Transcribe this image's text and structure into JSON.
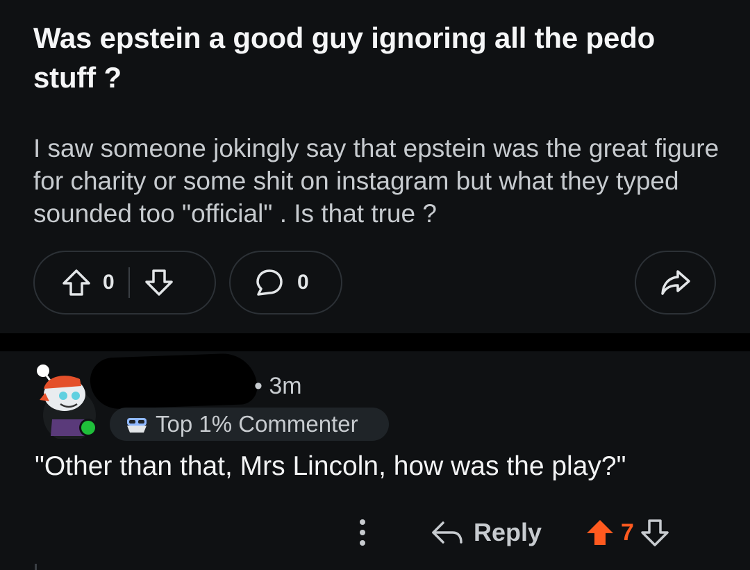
{
  "post": {
    "title": "Was epstein a good guy ignoring all the pedo stuff ?",
    "body": "I saw someone jokingly say that epstein was the great figure for charity or some shit on instagram but what they typed sounded too \"official\" . Is that true ?",
    "vote_count": "0",
    "comment_count": "0"
  },
  "comment": {
    "time": "• 3m",
    "badge": "Top 1% Commenter",
    "text": "\"Other than that, Mrs Lincoln, how was the play?\"",
    "reply_label": "Reply",
    "score": "7"
  },
  "icons": {
    "upvote": "arrow-up-outline-icon",
    "downvote": "arrow-down-outline-icon",
    "comment": "speech-bubble-icon",
    "share": "share-arrow-icon",
    "reply": "reply-arrow-icon",
    "more": "vertical-dots-icon",
    "upvoted": "arrow-up-filled-icon"
  },
  "colors": {
    "background": "#0f1113",
    "accent_upvote": "#ff5a1f",
    "online_dot": "#1fbf3a"
  }
}
